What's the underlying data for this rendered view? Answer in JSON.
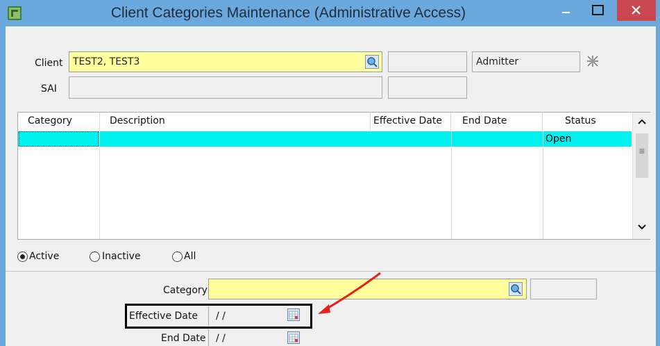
{
  "window": {
    "title": "Client Categories Maintenance (Administrative Access)",
    "controls": {
      "minimize": "–",
      "maximize": "□",
      "close": "✕"
    },
    "colors": {
      "titlebar": "#6aa8dd",
      "close": "#c9474f"
    }
  },
  "header": {
    "client_label": "Client",
    "client_value": "TEST2, TEST3",
    "admitter_value": "Admitter",
    "sai_label": "SAI",
    "sai_value": ""
  },
  "grid": {
    "columns": [
      "Category",
      "Description",
      "Effective Date",
      "End Date",
      "Status"
    ],
    "rows": [
      {
        "category": "",
        "description": "",
        "effective_date": "",
        "end_date": "",
        "status": "Open"
      }
    ],
    "row_highlight_color": "#00f0f0",
    "scroll_up_icon": "chevron-up-icon",
    "scroll_down_icon": "chevron-down-icon",
    "scroll_grip": "≡"
  },
  "filter": {
    "options": [
      "Active",
      "Inactive",
      "All"
    ],
    "selected": "Active"
  },
  "detail": {
    "category_label": "Category",
    "category_value": "",
    "effective_date_label": "Effective Date",
    "effective_date_value": "/ /",
    "end_date_label": "End Date",
    "end_date_value": "/ /"
  },
  "annotation": {
    "arrow_color": "#e8201a",
    "box_color": "#000000"
  }
}
